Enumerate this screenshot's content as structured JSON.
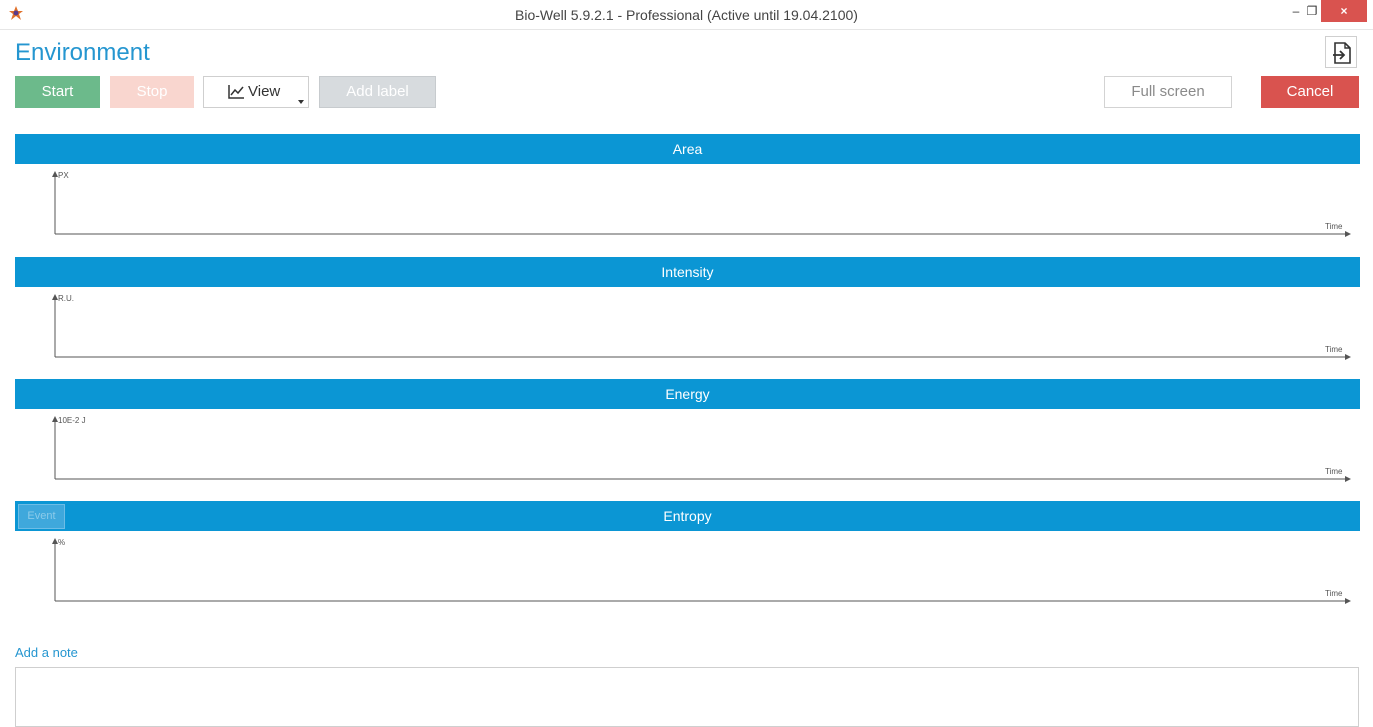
{
  "window": {
    "title": "Bio-Well 5.9.2.1 - Professional (Active until 19.04.2100)",
    "minimize_glyph": "–",
    "maximize_glyph": "❐",
    "close_glyph": "×"
  },
  "header": {
    "page_title": "Environment",
    "exit_icon": "exit-icon"
  },
  "toolbar": {
    "start_label": "Start",
    "stop_label": "Stop",
    "view_label": "View",
    "add_label_label": "Add label",
    "full_screen_label": "Full screen",
    "cancel_label": "Cancel"
  },
  "charts": [
    {
      "title": "Area",
      "y_unit": "PX",
      "x_unit": "Time"
    },
    {
      "title": "Intensity",
      "y_unit": "R.U.",
      "x_unit": "Time"
    },
    {
      "title": "Energy",
      "y_unit": "10E-2 J",
      "x_unit": "Time"
    },
    {
      "title": "Entropy",
      "y_unit": "%",
      "x_unit": "Time",
      "event_button": "Event"
    }
  ],
  "note": {
    "label": "Add a note",
    "value": ""
  },
  "colors": {
    "accent": "#0b96d4",
    "start": "#6cba8b",
    "stop": "#f9d6cf",
    "cancel": "#d9534f"
  }
}
